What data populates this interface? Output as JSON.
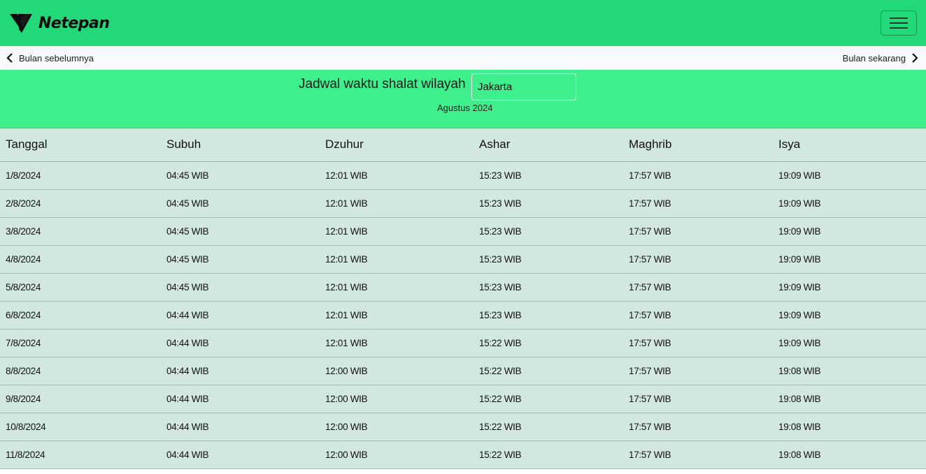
{
  "navbar": {
    "brand_name": "Netepan",
    "logo_icon": "v-logo-icon",
    "menu_icon": "hamburger-icon",
    "background": "#22d879"
  },
  "subnav": {
    "prev_label": "Bulan sebelumnya",
    "next_label": "Bulan sekarang",
    "prev_icon": "chevron-left-icon",
    "next_icon": "chevron-right-icon"
  },
  "header": {
    "title": "Jadwal waktu shalat wilayah",
    "region_value": "Jakarta",
    "month": "Agustus 2024",
    "background": "#3eef8c"
  },
  "table": {
    "columns": [
      "Tanggal",
      "Subuh",
      "Dzuhur",
      "Ashar",
      "Maghrib",
      "Isya"
    ],
    "rows": [
      [
        "1/8/2024",
        "04:45 WIB",
        "12:01 WIB",
        "15:23 WIB",
        "17:57 WIB",
        "19:09 WIB"
      ],
      [
        "2/8/2024",
        "04:45 WIB",
        "12:01 WIB",
        "15:23 WIB",
        "17:57 WIB",
        "19:09 WIB"
      ],
      [
        "3/8/2024",
        "04:45 WIB",
        "12:01 WIB",
        "15:23 WIB",
        "17:57 WIB",
        "19:09 WIB"
      ],
      [
        "4/8/2024",
        "04:45 WIB",
        "12:01 WIB",
        "15:23 WIB",
        "17:57 WIB",
        "19:09 WIB"
      ],
      [
        "5/8/2024",
        "04:45 WIB",
        "12:01 WIB",
        "15:23 WIB",
        "17:57 WIB",
        "19:09 WIB"
      ],
      [
        "6/8/2024",
        "04:44 WIB",
        "12:01 WIB",
        "15:23 WIB",
        "17:57 WIB",
        "19:09 WIB"
      ],
      [
        "7/8/2024",
        "04:44 WIB",
        "12:01 WIB",
        "15:22 WIB",
        "17:57 WIB",
        "19:09 WIB"
      ],
      [
        "8/8/2024",
        "04:44 WIB",
        "12:00 WIB",
        "15:22 WIB",
        "17:57 WIB",
        "19:08 WIB"
      ],
      [
        "9/8/2024",
        "04:44 WIB",
        "12:00 WIB",
        "15:22 WIB",
        "17:57 WIB",
        "19:08 WIB"
      ],
      [
        "10/8/2024",
        "04:44 WIB",
        "12:00 WIB",
        "15:22 WIB",
        "17:57 WIB",
        "19:08 WIB"
      ],
      [
        "11/8/2024",
        "04:44 WIB",
        "12:00 WIB",
        "15:22 WIB",
        "17:57 WIB",
        "19:08 WIB"
      ]
    ],
    "background": "#d2e7de"
  }
}
